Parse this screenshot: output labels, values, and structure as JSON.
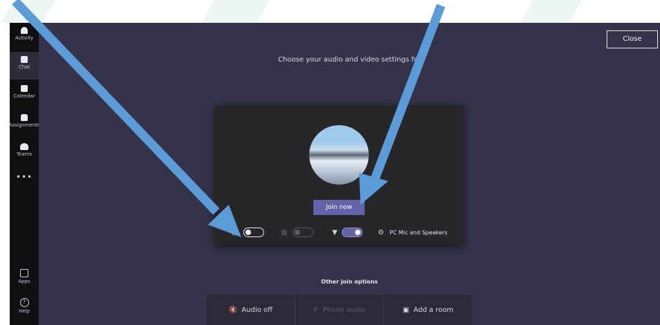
{
  "rail": {
    "items": [
      {
        "label": "Activity",
        "icon": "bell-icon"
      },
      {
        "label": "Chat",
        "icon": "chat-icon"
      },
      {
        "label": "Calendar",
        "icon": "calendar-icon"
      },
      {
        "label": "Assignments",
        "icon": "assignments-icon"
      },
      {
        "label": "Teams",
        "icon": "teams-icon"
      },
      {
        "label": "•••",
        "icon": "more-icon"
      }
    ],
    "bottom": [
      {
        "label": "Apps",
        "icon": "apps-icon"
      },
      {
        "label": "Help",
        "icon": "help-icon"
      }
    ],
    "active": "Chat"
  },
  "dialog": {
    "close_label": "Close",
    "heading": "Choose your audio and video settings for",
    "join_label": "Join now",
    "device_label": "PC Mic and Speakers",
    "camera_toggle": "off",
    "blur_toggle": "disabled",
    "mic_toggle": "on"
  },
  "other": {
    "title": "Other join options",
    "options": [
      {
        "label": "Audio off",
        "icon": "speaker-off-icon",
        "enabled": true
      },
      {
        "label": "Phone audio",
        "icon": "phone-icon",
        "enabled": false
      },
      {
        "label": "Add a room",
        "icon": "cast-icon",
        "enabled": true
      }
    ]
  },
  "colors": {
    "main_bg": "#34334a",
    "panel_bg": "#272629",
    "accent": "#6264a7",
    "rail_bg": "#0f0f12",
    "arrow": "#5b9bd8"
  }
}
